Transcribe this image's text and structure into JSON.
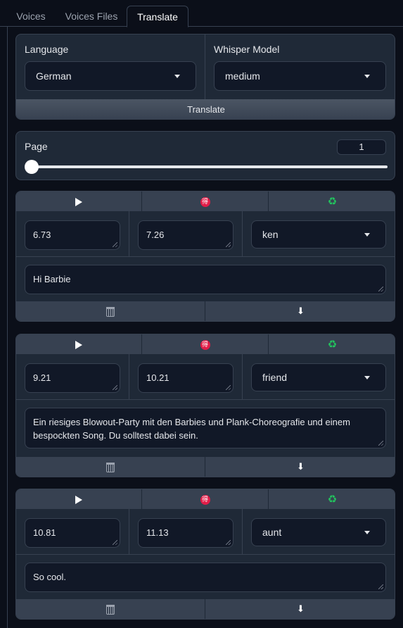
{
  "tabs": [
    "Voices",
    "Voices Files",
    "Translate"
  ],
  "controls": {
    "language_label": "Language",
    "language_value": "German",
    "whisper_label": "Whisper Model",
    "whisper_value": "medium",
    "translate_button": "Translate"
  },
  "page": {
    "label": "Page",
    "value": "1"
  },
  "segments": [
    {
      "start": "6.73",
      "end": "7.26",
      "speaker": "ken",
      "text": "Hi Barbie"
    },
    {
      "start": "9.21",
      "end": "10.21",
      "speaker": "friend",
      "text": " Ein riesiges Blowout-Party mit den Barbies und Plank-Choreografie und einem bespockten Song.  Du solltest dabei sein."
    },
    {
      "start": "10.81",
      "end": "11.13",
      "speaker": "aunt",
      "text": " So cool."
    }
  ],
  "icons": {
    "play": "play-icon",
    "translate": "translate-badge-icon",
    "regenerate": "recycle-icon",
    "delete": "trash-icon",
    "download": "download-icon"
  },
  "colors": {
    "background": "#0b0f19",
    "panel": "#1f2937",
    "input": "#111827",
    "border": "#374151",
    "badge": "#e11d48",
    "recycle": "#22c55e"
  }
}
